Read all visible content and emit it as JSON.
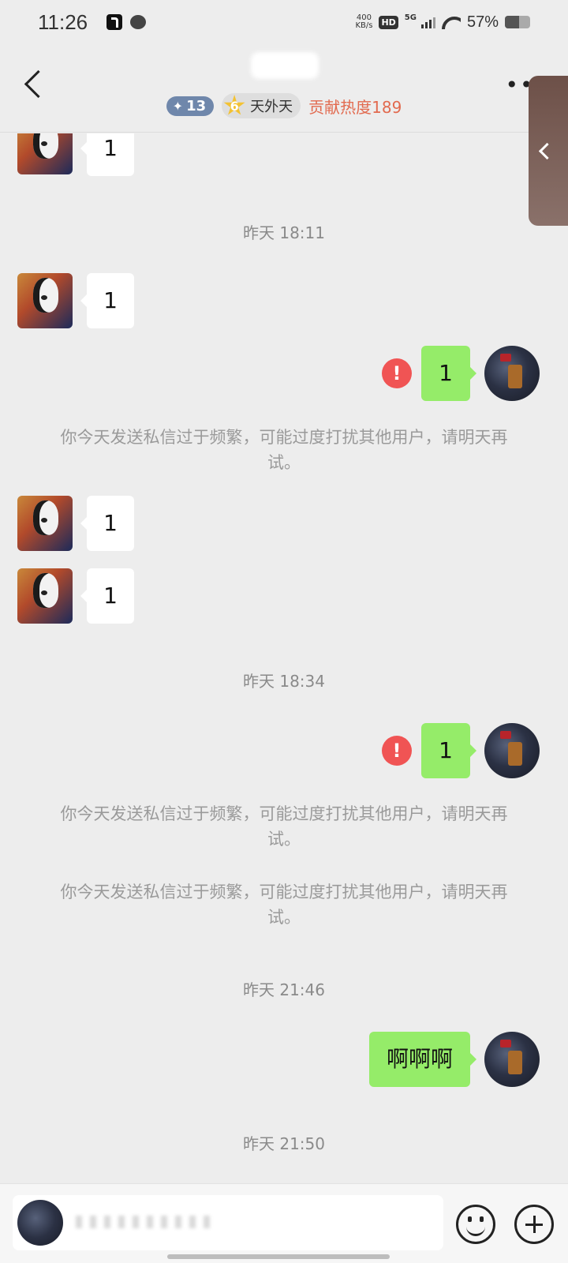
{
  "status_bar": {
    "time": "11:26",
    "net_speed_value": "400",
    "net_speed_unit": "KB/s",
    "hd_badge": "HD",
    "network": "5G",
    "battery_pct": "57%",
    "battery_level": 0.57
  },
  "header": {
    "level_badge": "13",
    "fan_level": "6",
    "fan_group": "天外天",
    "contribution": "贡献热度189"
  },
  "chat": {
    "incoming_msg_1": "1",
    "time_1": "昨天 18:11",
    "incoming_msg_2": "1",
    "outgoing_msg_1": "1",
    "send_error_icon": "!",
    "notice_1": "你今天发送私信过于频繁，可能过度打扰其他用户，请明天再试。",
    "incoming_msg_3": "1",
    "incoming_msg_4": "1",
    "time_2": "昨天 18:34",
    "outgoing_msg_2": "1",
    "notice_2": "你今天发送私信过于频繁，可能过度打扰其他用户，请明天再试。",
    "notice_3": "你今天发送私信过于频繁，可能过度打扰其他用户，请明天再试。",
    "time_3": "昨天 21:46",
    "outgoing_msg_3": "啊啊啊",
    "time_4": "昨天 21:50"
  },
  "icons": {
    "back": "chevron-left-icon",
    "more": "more-horizontal-icon",
    "emoji": "emoji-icon",
    "plus": "plus-circle-icon",
    "error": "error-icon"
  },
  "colors": {
    "outgoing_bubble": "#95ec69",
    "incoming_bubble": "#ffffff",
    "error": "#f05454",
    "heat_text": "#e26a4f",
    "level_badge": "#6f87ab"
  }
}
